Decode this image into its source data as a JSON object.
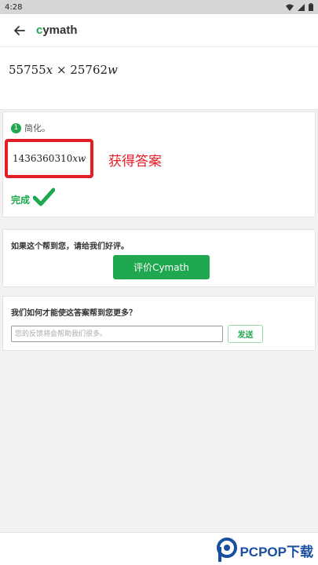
{
  "status_bar": {
    "time": "4:28"
  },
  "app_bar": {
    "title_c": "c",
    "title_rest": "ymath"
  },
  "problem": {
    "a": "55755",
    "var_a": "x",
    "op": "×",
    "b": "25762",
    "var_b": "w"
  },
  "step": {
    "number": "1",
    "label": "简化。",
    "answer_num": "1436360310",
    "answer_vars": "xw",
    "annotation": "获得答案",
    "done_label": "完成"
  },
  "rate": {
    "prompt": "如果这个帮到您，请给我们好评。",
    "button_label": "评价Cymath"
  },
  "feedback": {
    "question": "我们如何才能使这答案帮到您更多？",
    "placeholder": "您的反馈将会帮助我们很多。",
    "send_label": "发送"
  },
  "watermark": {
    "text": "PCPOP下载"
  },
  "colors": {
    "brand_green": "#1fa84f",
    "annotation_red": "#e31e24",
    "watermark_blue": "#1a4fa0"
  }
}
